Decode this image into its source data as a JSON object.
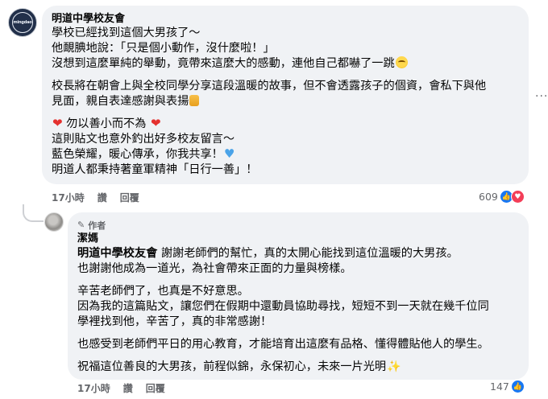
{
  "comment": {
    "author": "明道中學校友會",
    "avatar_text": "mingdao",
    "lines_p1": [
      "學校已經找到這個大男孩了～",
      "他靦腆地說：「只是個小動作，沒什麼啦！」",
      "沒想到這麼單純的舉動，竟帶來這麼大的感動，連他自己都嚇了一跳"
    ],
    "lines_p2": [
      "校長將在朝會上與全校同學分享這段溫暖的故事，但不會透露孩子的個資，會私下與他",
      "見面，親自表達感謝與表揚"
    ],
    "lines_p3": [
      "勿以善小而不為",
      "這則貼文也意外釣出好多校友留言～",
      "藍色榮耀，暖心傳承，你我共享！",
      "明道人都秉持著童軍精神「日行一善」！"
    ],
    "actions": {
      "time": "17小時",
      "like": "讚",
      "reply": "回覆"
    },
    "reaction_count": "609",
    "reaction_icons": [
      "like-icon",
      "love-icon"
    ]
  },
  "reply": {
    "badge": "作者",
    "author": "潔媽",
    "mention": "明道中學校友會",
    "lines_p1_first": " 謝謝老師們的幫忙，真的太開心能找到這位溫暖的大男孩。",
    "lines_p1": [
      "也謝謝他成為一道光，為社會帶來正面的力量與榜樣。"
    ],
    "lines_p2": [
      "辛苦老師們了，也真是不好意思。",
      "因為我的這篇貼文，讓您們在假期中還動員協助尋找，短短不到一天就在幾千位同",
      "學裡找到他，辛苦了，真的非常感謝！"
    ],
    "lines_p3": [
      "也感受到老師們平日的用心教育，才能培育出這麼有品格、懂得體貼他人的學生。"
    ],
    "lines_p4": [
      "祝福這位善良的大男孩，前程似錦，永保初心，未來一片光明"
    ],
    "actions": {
      "time": "17小時",
      "like": "讚",
      "reply": "回覆"
    },
    "reaction_count": "147",
    "reaction_icons": [
      "like-icon"
    ]
  },
  "more_menu": "···",
  "colors": {
    "bubble": "#f0f2f5",
    "meta": "#65676b",
    "like_blue": "#1877f2",
    "love_red": "#f33e58"
  }
}
